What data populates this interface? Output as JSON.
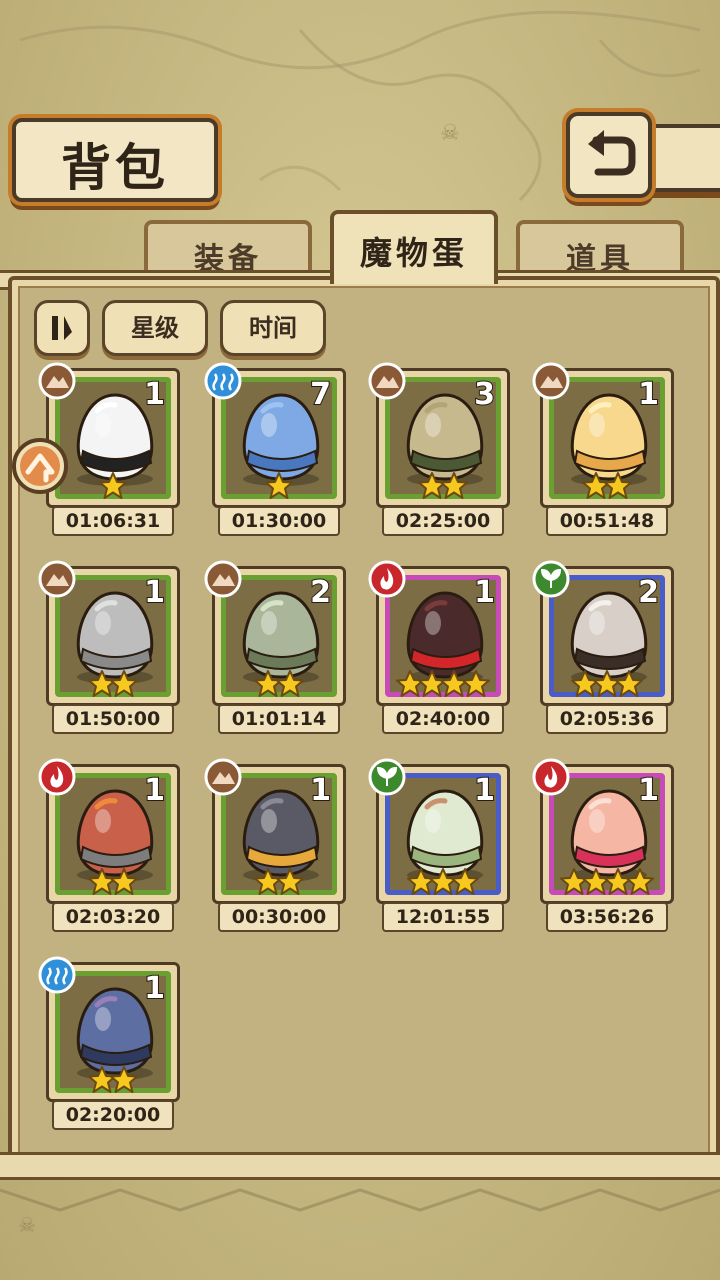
{
  "title": "背包",
  "tabs": [
    {
      "label": "装备",
      "active": false
    },
    {
      "label": "魔物蛋",
      "active": true
    },
    {
      "label": "道具",
      "active": false
    }
  ],
  "sort": {
    "star_label": "星级",
    "time_label": "时间"
  },
  "eggs": [
    {
      "count": "1",
      "stars": 1,
      "rarity": 1,
      "element": "earth-icon",
      "time": "01:06:31",
      "egg": "white-striped-egg"
    },
    {
      "count": "7",
      "stars": 1,
      "rarity": 1,
      "element": "water-icon",
      "time": "01:30:00",
      "egg": "blue-egg"
    },
    {
      "count": "3",
      "stars": 2,
      "rarity": 2,
      "element": "earth-icon",
      "time": "02:25:00",
      "egg": "vine-egg"
    },
    {
      "count": "1",
      "stars": 2,
      "rarity": 2,
      "element": "earth-icon",
      "time": "00:51:48",
      "egg": "cloud-egg"
    },
    {
      "count": "1",
      "stars": 2,
      "rarity": 2,
      "element": "earth-icon",
      "time": "01:50:00",
      "egg": "grey-egg"
    },
    {
      "count": "2",
      "stars": 2,
      "rarity": 2,
      "element": "earth-icon",
      "time": "01:01:14",
      "egg": "leaf-egg"
    },
    {
      "count": "1",
      "stars": 4,
      "rarity": 4,
      "element": "fire-icon",
      "time": "02:40:00",
      "egg": "dark-fire-egg"
    },
    {
      "count": "2",
      "stars": 3,
      "rarity": 3,
      "element": "wood-icon",
      "time": "02:05:36",
      "egg": "spiked-egg"
    },
    {
      "count": "1",
      "stars": 2,
      "rarity": 2,
      "element": "fire-icon",
      "time": "02:03:20",
      "egg": "lava-egg"
    },
    {
      "count": "1",
      "stars": 2,
      "rarity": 2,
      "element": "earth-icon",
      "time": "00:30:00",
      "egg": "hat-egg"
    },
    {
      "count": "1",
      "stars": 3,
      "rarity": 3,
      "element": "wood-icon",
      "time": "12:01:55",
      "egg": "spiral-leaf-egg"
    },
    {
      "count": "1",
      "stars": 4,
      "rarity": 4,
      "element": "fire-icon",
      "time": "03:56:26",
      "egg": "kimono-egg"
    },
    {
      "count": "1",
      "stars": 2,
      "rarity": 2,
      "element": "water-icon",
      "time": "02:20:00",
      "egg": "shell-egg"
    }
  ],
  "colors": {
    "earth": "#8a5a36",
    "water": "#2f8fd8",
    "fire": "#c8272b",
    "wood": "#3d8a2e",
    "star": "#f7c81e"
  }
}
